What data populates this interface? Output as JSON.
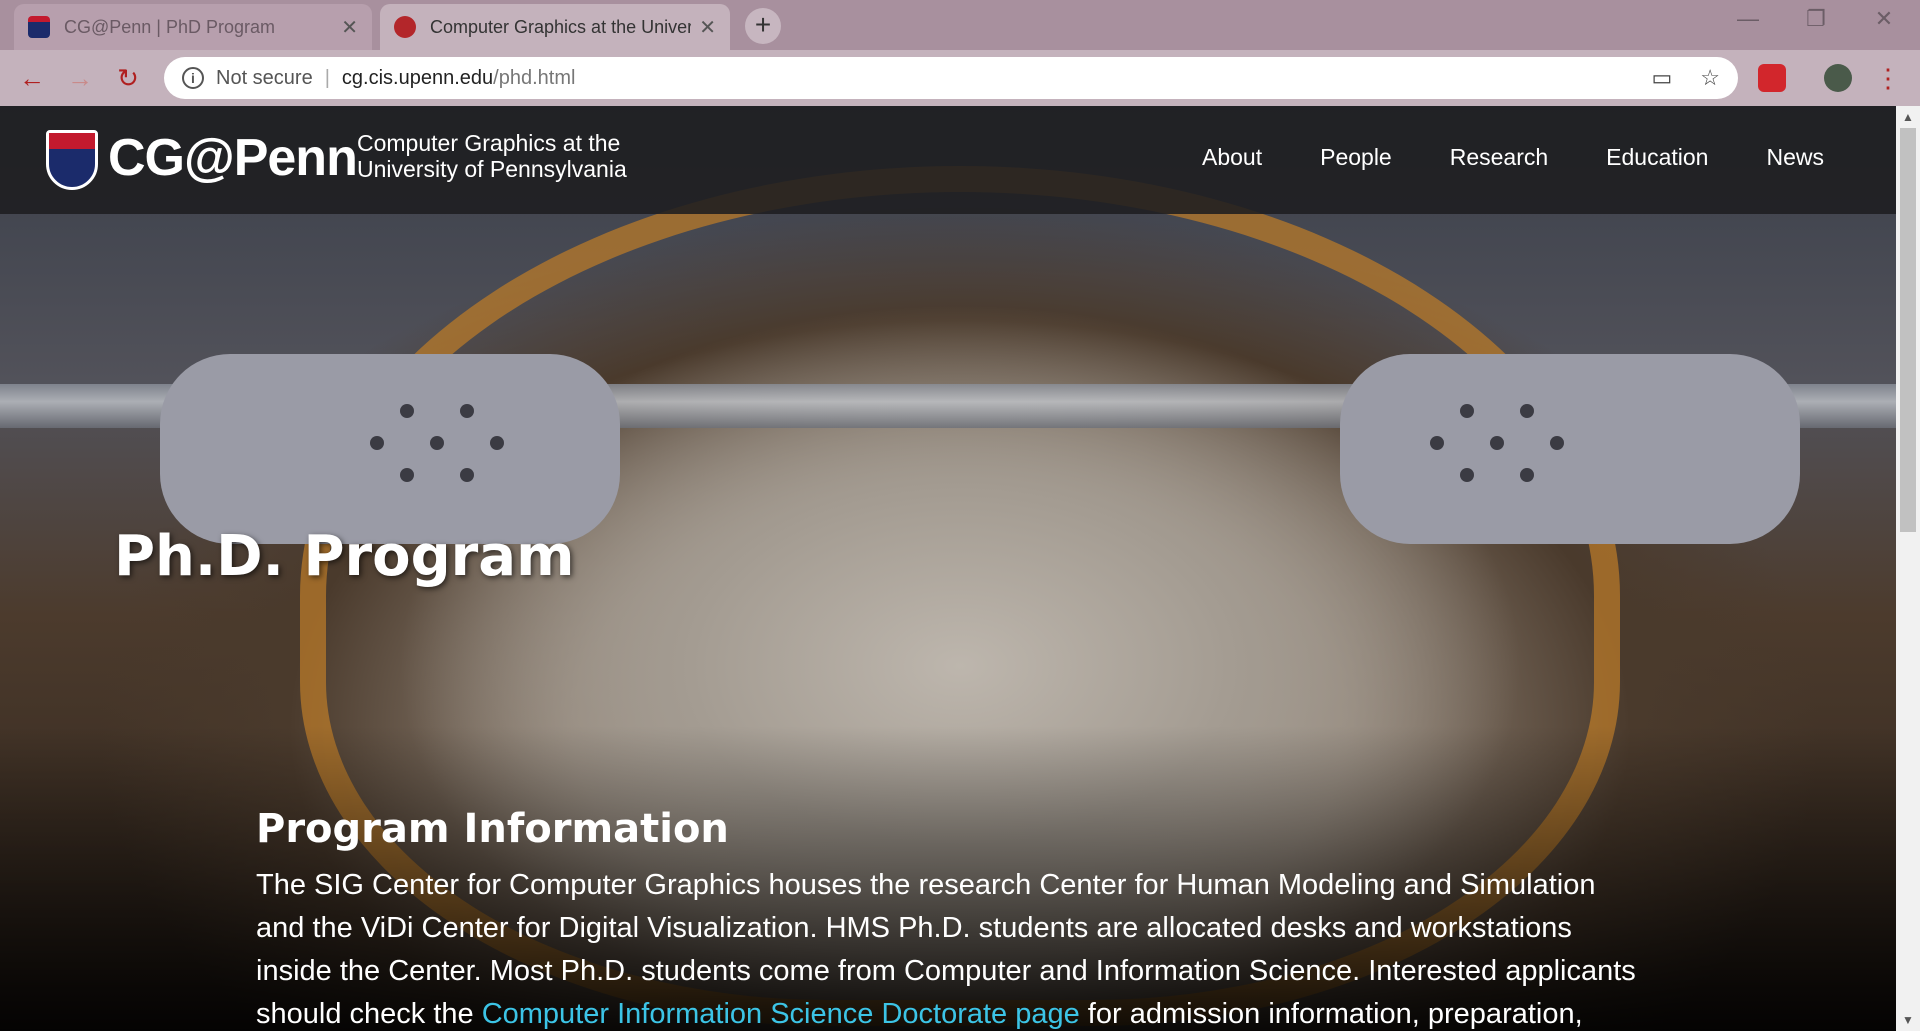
{
  "browser": {
    "tabs": [
      {
        "title": "CG@Penn | PhD Program",
        "active": false
      },
      {
        "title": "Computer Graphics at the Univer",
        "active": true
      }
    ],
    "newtab_icon": "+",
    "controls": {
      "minimize": "—",
      "restore": "❐",
      "close": "✕"
    },
    "close_icon": "✕",
    "nav": {
      "back": "←",
      "forward": "→",
      "reload": "↻"
    },
    "address": {
      "security": "Not secure",
      "info_icon": "i",
      "separator": "|",
      "host": "cg.cis.upenn.edu",
      "path": "/phd.html"
    },
    "icons": {
      "cast": "▭",
      "bookmark": "☆",
      "menu": "⋮"
    }
  },
  "site": {
    "brand": "CG@Penn",
    "tagline_line1": "Computer Graphics at the",
    "tagline_line2": "University of Pennsylvania",
    "menu": [
      "About",
      "People",
      "Research",
      "Education",
      "News"
    ],
    "page_title": "Ph.D. Program",
    "section_title": "Program Information",
    "paragraph_part1": "The SIG Center for Computer Graphics houses the research Center for Human Modeling and Simulation and the ViDi Center for Digital Visualization. HMS Ph.D. students are allocated desks and workstations inside the Center. Most Ph.D. students come from Computer and Information Science. Interested applicants should check the ",
    "link_text": "Computer Information Science Doctorate page",
    "paragraph_part2": " for admission information, preparation, and degree"
  },
  "colors": {
    "accent_red": "#c31a2e",
    "penn_blue": "#1b2b6b",
    "link": "#3cc4e6"
  }
}
